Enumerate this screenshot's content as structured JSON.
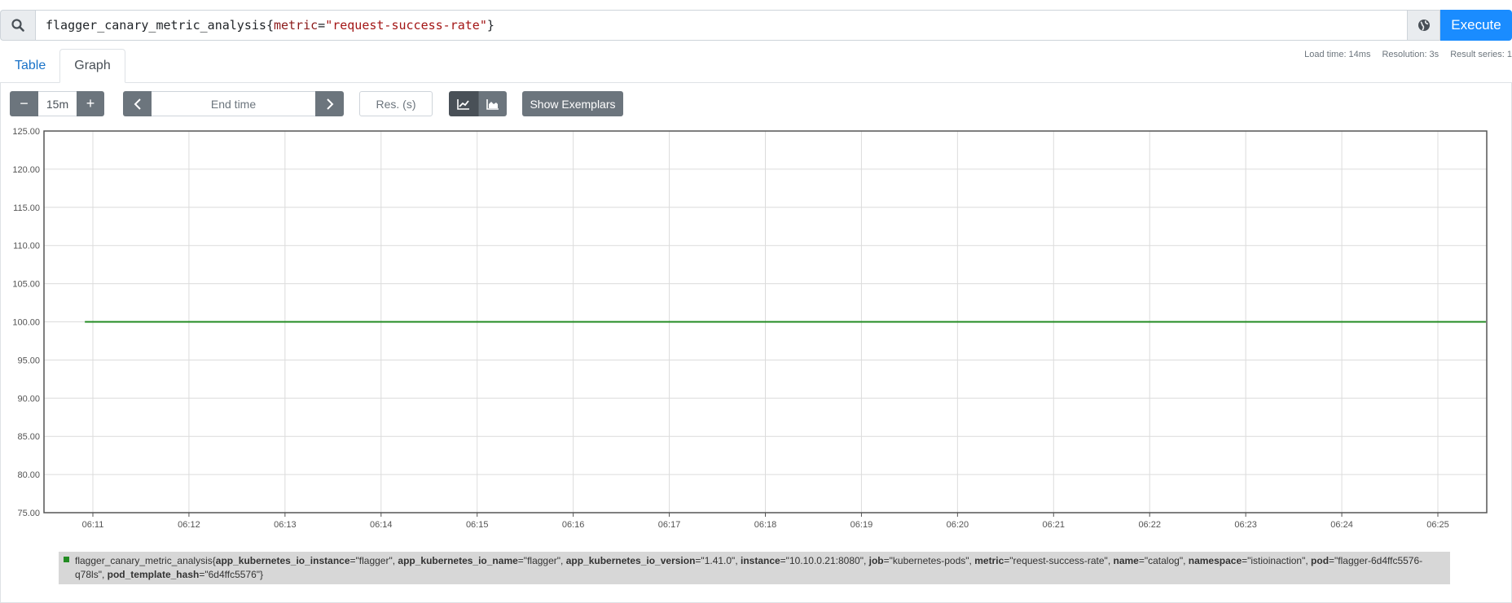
{
  "query": {
    "metric_name": "flagger_canary_metric_analysis",
    "label_name": "metric",
    "label_value": "\"request-success-rate\"",
    "execute_label": "Execute"
  },
  "tabs": [
    {
      "label": "Table",
      "active": false
    },
    {
      "label": "Graph",
      "active": true
    }
  ],
  "stats": {
    "load_time": "Load time: 14ms",
    "resolution": "Resolution: 3s",
    "result_series": "Result series: 1"
  },
  "controls": {
    "minus": "−",
    "range": "15m",
    "plus": "+",
    "end_time_placeholder": "End time",
    "res_placeholder": "Res. (s)",
    "exemplars_label": "Show Exemplars"
  },
  "chart_data": {
    "type": "line",
    "y_ticks": [
      "125.00",
      "120.00",
      "115.00",
      "110.00",
      "105.00",
      "100.00",
      "95.00",
      "90.00",
      "85.00",
      "80.00",
      "75.00"
    ],
    "ylim": [
      75,
      125
    ],
    "x_ticks": [
      "06:11",
      "06:12",
      "06:13",
      "06:14",
      "06:15",
      "06:16",
      "06:17",
      "06:18",
      "06:19",
      "06:20",
      "06:21",
      "06:22",
      "06:23",
      "06:24",
      "06:25"
    ],
    "series": [
      {
        "color": "#228b22",
        "x": [
          "06:10:55",
          "06:25:30"
        ],
        "values": [
          100,
          100
        ]
      }
    ],
    "grid": true
  },
  "legend": {
    "color": "#228b22",
    "metric": "flagger_canary_metric_analysis",
    "labels": [
      {
        "k": "app_kubernetes_io_instance",
        "v": "\"flagger\""
      },
      {
        "k": "app_kubernetes_io_name",
        "v": "\"flagger\""
      },
      {
        "k": "app_kubernetes_io_version",
        "v": "\"1.41.0\""
      },
      {
        "k": "instance",
        "v": "\"10.10.0.21:8080\""
      },
      {
        "k": "job",
        "v": "\"kubernetes-pods\""
      },
      {
        "k": "metric",
        "v": "\"request-success-rate\""
      },
      {
        "k": "name",
        "v": "\"catalog\""
      },
      {
        "k": "namespace",
        "v": "\"istioinaction\""
      },
      {
        "k": "pod",
        "v": "\"flagger-6d4ffc5576-q78ls\""
      },
      {
        "k": "pod_template_hash",
        "v": "\"6d4ffc5576\""
      }
    ]
  }
}
